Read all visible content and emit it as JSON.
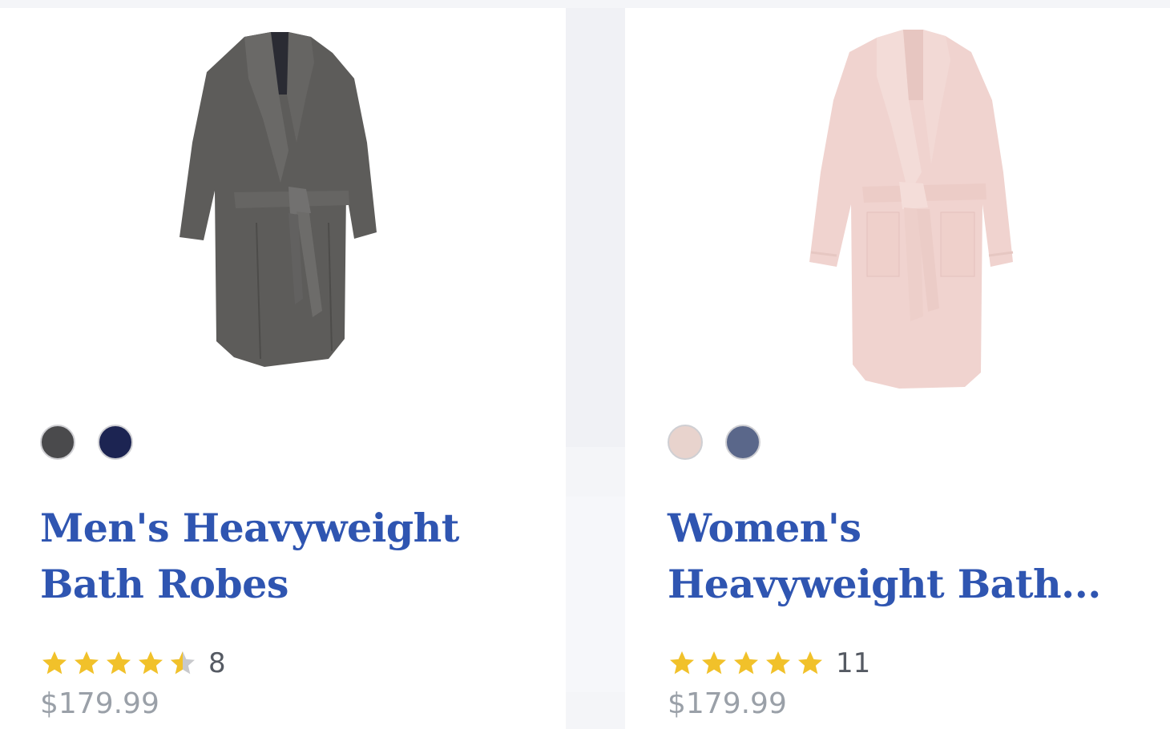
{
  "products": [
    {
      "title_line1": "Men's Heavyweight",
      "title_line2": "Bath Robes",
      "rating": 4.5,
      "review_count": "8",
      "price": "$179.99",
      "swatches": [
        {
          "name": "charcoal",
          "color": "#4a4a4c"
        },
        {
          "name": "navy",
          "color": "#1c2452"
        }
      ],
      "image_icon": "gray-bathrobe-image",
      "robe_color": "#5e5d5b"
    },
    {
      "title_line1": "Women's",
      "title_line2": "Heavyweight Bath...",
      "rating": 5,
      "review_count": "11",
      "price": "$179.99",
      "swatches": [
        {
          "name": "blush",
          "color": "#e8d3cd"
        },
        {
          "name": "slate-blue",
          "color": "#5a678a"
        }
      ],
      "image_icon": "pink-bathrobe-image",
      "robe_color": "#f0d3cf"
    }
  ],
  "colors": {
    "title": "#2f55b1",
    "star_filled": "#f1c12a",
    "star_empty": "#c8c9cc"
  }
}
